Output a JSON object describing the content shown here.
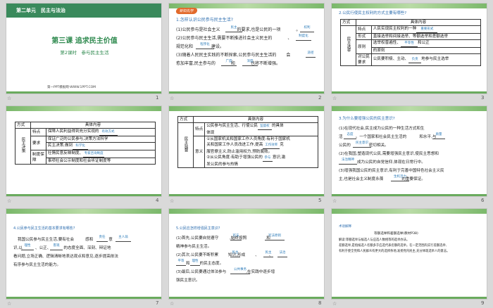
{
  "slides": [
    {
      "num": "1",
      "unit": "第二单元　民主与法治",
      "lesson": "第三课 追求民主价值",
      "sub": "第2课时　参与民主生活",
      "footer": "第一PPT模板网-WWW.1PPT.COM"
    },
    {
      "num": "2",
      "badge": "新知先学",
      "q": "1.怎样认识公民参与民主生活?",
      "l1": "(1)公民参与是社会主义",
      "f1": "民主",
      "l1b": "的要求,也是公民的一项",
      "f1b": "权利",
      "l1c": "。",
      "l2": "(2)公民参与民主生活,需要不断推进社会主义民主的",
      "f2": "制度化",
      "l2b": "、",
      "l3a": "规范化和",
      "f3": "程序化",
      "l3b": "建设。",
      "l4": "(3)随着人民民主实践的不断探索,公民参与民主生活的",
      "f4": "途径",
      "l4b": "会",
      "l5": "愈加丰富,民主参与的",
      "f5": "广度",
      "l5b": "和",
      "f5b": "深度",
      "l5c": "也将不断增强。"
    },
    {
      "num": "3",
      "q": "2.公民行使民主权利的方式主要有哪些?",
      "h1": "方式",
      "h2": "具体内容",
      "group": "民主选举",
      "r1a": "特点",
      "r1b": "人民实现民主权利的一种",
      "f1": "重要形式",
      "r2a": "形式",
      "r2b": "直接选举和间接选举、等额选举和差额选举",
      "r3a": "原则",
      "r3b": "选举权普遍性、",
      "f3": "平等性",
      "r3c": "和公正",
      "r3d": "的原则",
      "r4a": "对公民",
      "r4b": "要求",
      "r4c": "公民要积极、主动、",
      "f4": "负责",
      "r4d": "地参与民主选举"
    },
    {
      "num": "4",
      "h1": "方式",
      "h2": "具体内容",
      "group": "民主决策",
      "r1a": "特点",
      "r1b": "保障人民利益得到充分实现的",
      "f1": "有效方式",
      "r2a": "要求",
      "r2b": "保证广泛的公民参与,决策方法科学",
      "r2c": "民主决策,做到",
      "f2": "科学化",
      "r3a": "制度保",
      "r3b": "障",
      "r3c": "社情民意反映制度、",
      "f3": "专家咨询制度",
      "r3d": "事项社会公示制度和社会听证制度等"
    },
    {
      "num": "5",
      "h1": "方式",
      "h2": "具体内容",
      "group": "民主监督",
      "r1a": "特点",
      "r1b": "公民参与民主生活、行使公民",
      "f1": "监督权",
      "r1c": "的具体",
      "r1d": "体现",
      "r2a": "意义",
      "r2b": "①从国家机关和国家工作人员角度:有利于国家机",
      "r2c": "关和国家工作人员改进工作,提高",
      "f2": "工作效率",
      "r2d": "克",
      "r2e": "服官僚主义,防止滥用权力,预防腐败。",
      "r2f": "②从公民角度:有助于增强公民的",
      "f3": "参与",
      "r2g": "意识,激",
      "r2h": "发公民的参与热情"
    },
    {
      "num": "6",
      "q": "3.为什么要增强公民的民主意识?",
      "l1": "(1)在现代社会,民主成为公民的一种生活方式和生",
      "l2a": "活",
      "f2": "态度",
      "l2b": "。一个国家和社会民主生活的",
      "f2b": "质量",
      "l2c": "和水平,与",
      "l3a": "公民的",
      "f3": "民主意识",
      "l3b": "密切相关。",
      "l4": "(2)在我国,塑造现代公民,需要增强民主意识,使民主思想和",
      "l5a": "",
      "f5": "法治精神",
      "l5b": "成为公民的自觉信仰,体现在日常行中。",
      "l6": "(3)增强我国公民的民主意识,有利于完善中国特色社会主义民",
      "l7a": "主,也是社会主义制度永葆",
      "f7": "生机活力",
      "l7b": "的重要保证。"
    },
    {
      "num": "7",
      "q": "4.公民参与民主生活的基本要求有哪些?",
      "l1a": "我国公民参与民主生活,要有社会",
      "f1": "责任",
      "l1b": "感和",
      "f1b": "主人翁",
      "l1c": "意",
      "l2a": "识,以",
      "f2": "理性",
      "l2b": "、公正、",
      "f2b": "客观",
      "l2c": "的态度全面、深刻、辩证地",
      "l3": "看问题,立场正确、逻辑清晰地表达观点和意见,逐步提高依法",
      "l4": "有序参与民主生活的能力。"
    },
    {
      "num": "8",
      "q": "5.公民应怎样增强民主意识?",
      "l1a": "(1)首先,公民要自觉遵守",
      "f1": "宪法",
      "l1b": ",始终按照",
      "f1b": "宪法原则",
      "l1c": "和",
      "l2": "精神参与民主生活。",
      "l3a": "(2)其次,公民要不断积累",
      "f3": "民主",
      "l3b": "知识,形成",
      "f3b": "民主",
      "l3c": "、",
      "f3c": "法治",
      "l3d": "、",
      "l4a": "",
      "f4": "平等",
      "l4b": "和",
      "f4b": "理性",
      "l4c": "的民主态度。",
      "l5a": "(3)最后,公民要通过体法参与",
      "f5": "公共事务",
      "l5b": ",在实践中逐步增",
      "l6": "强民主意识。"
    },
    {
      "num": "9",
      "cap": "术语解释",
      "t1": "等额选举和差额选举(教材P38)",
      "b1": "解读:等额选举与候选人与应选人数相等的选举办法。",
      "b2": "差额选举,是指候选人名额多于应选代表名额的选举。在一定范围内实行差额选举,",
      "b3": "有利于使全党和人民群众有更大的选择余地,发扬党内民主,充分体现选举人的意志。"
    }
  ],
  "icon_names": [
    "slide-indicator-icon"
  ]
}
